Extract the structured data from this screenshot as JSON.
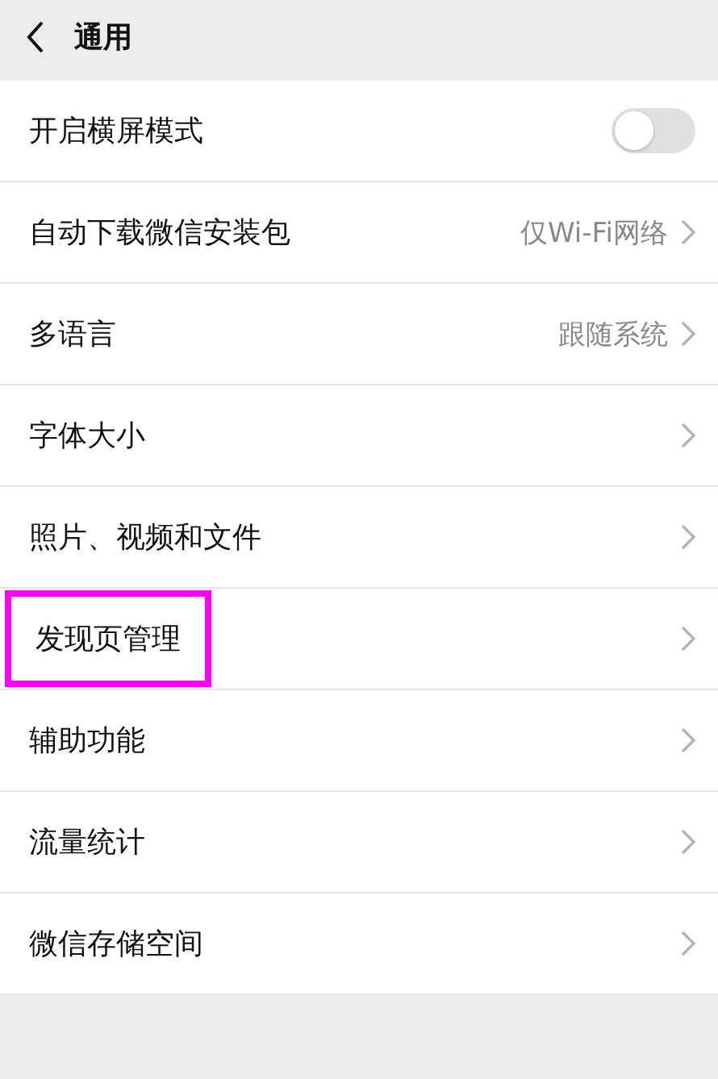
{
  "header": {
    "title": "通用"
  },
  "items": [
    {
      "kind": "toggle",
      "label": "开启横屏模式",
      "on": false,
      "highlighted": false
    },
    {
      "kind": "link",
      "label": "自动下载微信安装包",
      "value": "仅Wi-Fi网络",
      "highlighted": false
    },
    {
      "kind": "link",
      "label": "多语言",
      "value": "跟随系统",
      "highlighted": false
    },
    {
      "kind": "link",
      "label": "字体大小",
      "highlighted": false
    },
    {
      "kind": "link",
      "label": "照片、视频和文件",
      "highlighted": false
    },
    {
      "kind": "link",
      "label": "发现页管理",
      "highlighted": true
    },
    {
      "kind": "link",
      "label": "辅助功能",
      "highlighted": false
    },
    {
      "kind": "link",
      "label": "流量统计",
      "highlighted": false
    },
    {
      "kind": "link",
      "label": "微信存储空间",
      "highlighted": false
    }
  ]
}
